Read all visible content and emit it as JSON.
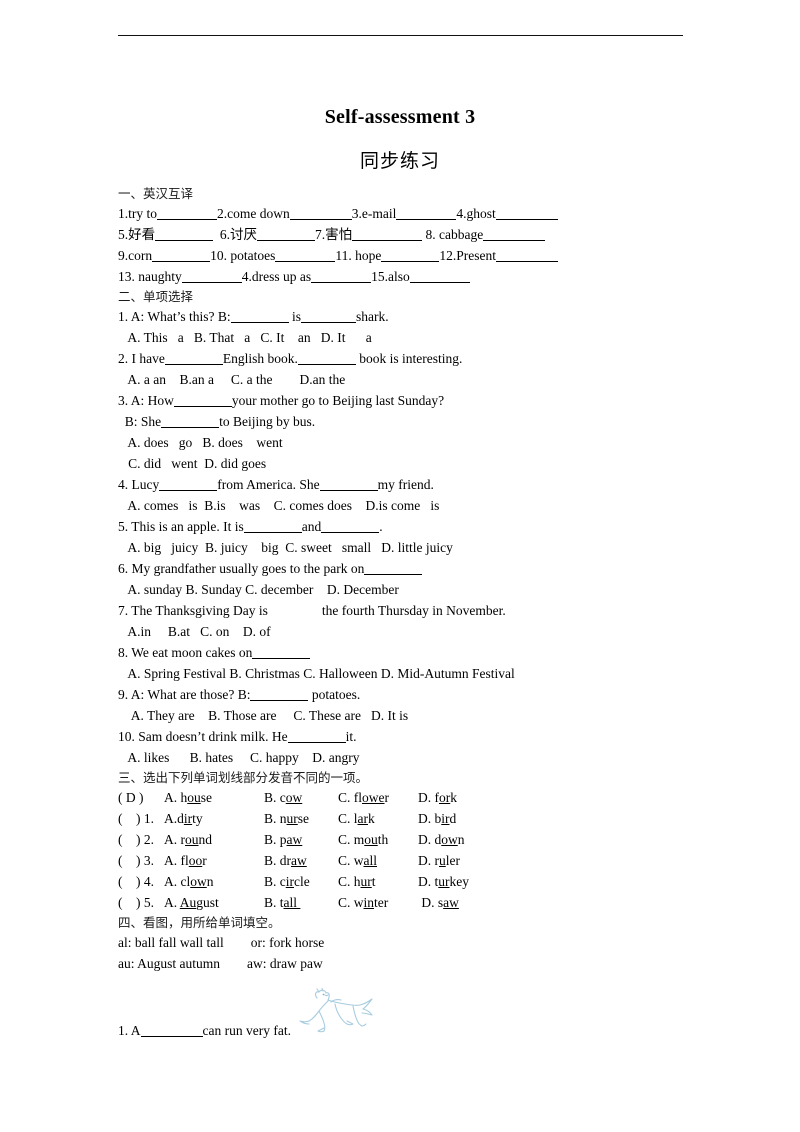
{
  "title": "Self-assessment 3",
  "subtitle": "同步练习",
  "section1": {
    "heading": "一、英汉互译",
    "rows": [
      [
        {
          "text": "1.try to",
          "blank": 60
        },
        {
          "text": "2.come down",
          "blank": 62
        },
        {
          "text": "3.e-mail",
          "blank": 60
        },
        {
          "text": "4.ghost",
          "blank": 62
        }
      ],
      [
        {
          "text": "5.好看",
          "blank": 58,
          "after": "  "
        },
        {
          "text": "6.讨厌",
          "blank": 58
        },
        {
          "text": "7.害怕",
          "blank": 70,
          "after": " "
        },
        {
          "text": "8. cabbage",
          "blank": 62
        }
      ],
      [
        {
          "text": "9.corn",
          "blank": 58
        },
        {
          "text": "10. potatoes",
          "blank": 60
        },
        {
          "text": "11. hope",
          "blank": 58
        },
        {
          "text": "12.Present",
          "blank": 62
        }
      ],
      [
        {
          "text": "13. naughty",
          "blank": 60
        },
        {
          "text": "4.dress up as",
          "blank": 60
        },
        {
          "text": "15.also",
          "blank": 60
        }
      ]
    ]
  },
  "section2": {
    "heading": "二、单项选择",
    "questions": [
      {
        "stem": [
          {
            "text": "1. A: What’s this? B:",
            "blank": 58
          },
          {
            "text": " is",
            "blank": 55
          },
          {
            "text": "shark."
          }
        ],
        "options": "   A. This   a   B. That   a   C. It    an   D. It      a"
      },
      {
        "stem": [
          {
            "text": "2. I have",
            "blank": 58
          },
          {
            "text": "English book.",
            "blank": 58
          },
          {
            "text": " book is interesting."
          }
        ],
        "options": "   A. a an    B.an a     C. a the        D.an the"
      },
      {
        "stem": [
          {
            "text": "3. A: How",
            "blank": 58
          },
          {
            "text": "your mother go to Beijing last Sunday?"
          }
        ],
        "stem2": [
          {
            "text": "  B: She",
            "blank": 58
          },
          {
            "text": "to Beijing by bus."
          }
        ],
        "options": "   A. does   go   B. does    went",
        "options2": "   C. did   went  D. did goes"
      },
      {
        "stem": [
          {
            "text": "4. Lucy",
            "blank": 58
          },
          {
            "text": "from America. She",
            "blank": 58
          },
          {
            "text": "my friend."
          }
        ],
        "options": "   A. comes   is  B.is    was    C. comes does    D.is come   is"
      },
      {
        "stem": [
          {
            "text": "5. This is an apple. It is",
            "blank": 58
          },
          {
            "text": "and",
            "blank": 58
          },
          {
            "text": "."
          }
        ],
        "options": "   A. big   juicy  B. juicy    big  C. sweet   small   D. little juicy"
      },
      {
        "stem": [
          {
            "text": "6. My grandfather usually goes to the park on",
            "blank": 58
          }
        ],
        "options": "   A. sunday B. Sunday C. december    D. December"
      },
      {
        "stem": [
          {
            "text": "7. The Thanksgiving Day is",
            "gap": 54
          },
          {
            "text": "the fourth Thursday in November."
          }
        ],
        "options": "   A.in     B.at   C. on    D. of"
      },
      {
        "stem": [
          {
            "text": "8. We eat moon cakes on",
            "blank": 58
          }
        ],
        "options": "   A. Spring Festival B. Christmas C. Halloween D. Mid-Autumn Festival"
      },
      {
        "stem": [
          {
            "text": "9. A: What are those? B:",
            "blank": 58
          },
          {
            "text": " potatoes."
          }
        ],
        "options": "    A. They are    B. Those are     C. These are   D. It is"
      },
      {
        "stem": [
          {
            "text": "10. Sam doesn’t drink milk. He",
            "blank": 58
          },
          {
            "text": "it."
          }
        ],
        "options": "   A. likes      B. hates     C. happy    D. angry"
      }
    ]
  },
  "section3": {
    "heading": "三、选出下列单词划线部分发音不同的一项。",
    "rows": [
      {
        "mark": "( D )",
        "a": {
          "pre": "A. h",
          "u": "ou",
          "post": "se"
        },
        "b": {
          "pre": "B. c",
          "u": "ow",
          "post": ""
        },
        "c": {
          "pre": "C. fl",
          "u": "owe",
          "post": "r"
        },
        "d": {
          "pre": "D. f",
          "u": "or",
          "post": "k"
        }
      },
      {
        "mark": "(    ) 1.",
        "a": {
          "pre": "A.d",
          "u": "ir",
          "post": "ty"
        },
        "b": {
          "pre": "B. n",
          "u": "ur",
          "post": "se"
        },
        "c": {
          "pre": "C. l",
          "u": "ar",
          "post": "k"
        },
        "d": {
          "pre": "D. b",
          "u": "ir",
          "post": "d"
        }
      },
      {
        "mark": "(    ) 2.",
        "a": {
          "pre": "A. r",
          "u": "ou",
          "post": "nd"
        },
        "b": {
          "pre": "B. p",
          "u": "aw",
          "post": ""
        },
        "c": {
          "pre": "C. m",
          "u": "ou",
          "post": "th"
        },
        "d": {
          "pre": "D. d",
          "u": "ow",
          "post": "n"
        }
      },
      {
        "mark": "(    ) 3.",
        "a": {
          "pre": "A. fl",
          "u": "oo",
          "post": "r"
        },
        "b": {
          "pre": "B. dr",
          "u": "aw",
          "post": ""
        },
        "c": {
          "pre": "C. w",
          "u": "all",
          "post": ""
        },
        "d": {
          "pre": "D. r",
          "u": "u",
          "post": "ler"
        }
      },
      {
        "mark": "(    ) 4.",
        "a": {
          "pre": "A. cl",
          "u": "ow",
          "post": "n"
        },
        "b": {
          "pre": "B. c",
          "u": "ir",
          "post": "cle"
        },
        "c": {
          "pre": "C. h",
          "u": "ur",
          "post": "t"
        },
        "d": {
          "pre": "D. t",
          "u": "ur",
          "post": "key"
        }
      },
      {
        "mark": "(    ) 5.",
        "a": {
          "pre": "A. ",
          "u": "Au",
          "post": "gust"
        },
        "b": {
          "pre": "B. t",
          "u": "all ",
          "post": ""
        },
        "c": {
          "pre": "C. w",
          "u": "in",
          "post": "ter"
        },
        "d": {
          "pre": " D. s",
          "u": "aw",
          "post": ""
        }
      }
    ]
  },
  "section4": {
    "heading": "四、看图，用所给单词填空。",
    "bank_line1": "al: ball fall wall tall        or: fork horse",
    "bank_line2": "au: August autumn        aw: draw paw",
    "question1_pre": "1. A",
    "question1_blank": 62,
    "question1_post": "can run very fat.",
    "illustration": "horse-line-drawing",
    "illustration_color": "#a8cde0"
  }
}
